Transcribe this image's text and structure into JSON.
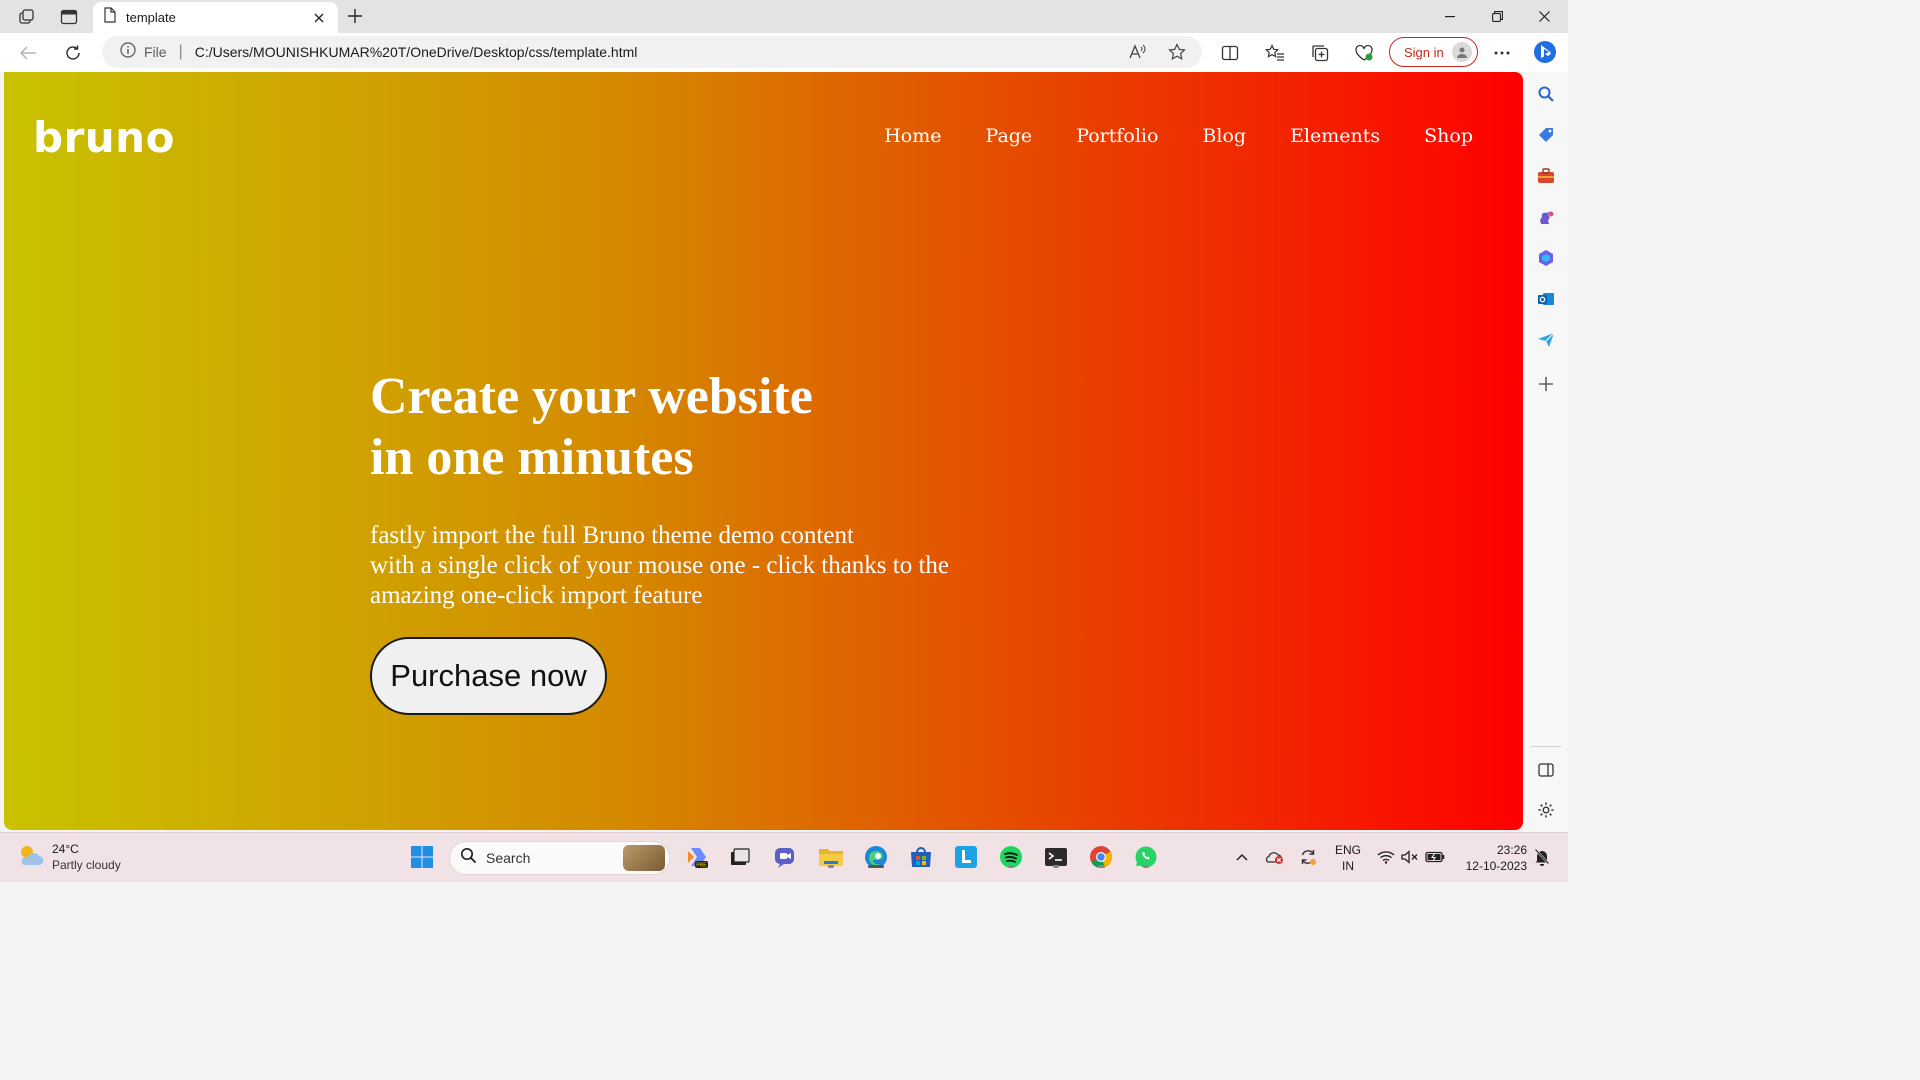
{
  "browser": {
    "tab_title": "template",
    "address": {
      "scheme_label": "File",
      "url": "C:/Users/MOUNISHKUMAR%20T/OneDrive/Desktop/css/template.html"
    },
    "signin_label": "Sign in"
  },
  "page": {
    "logo": "bruno",
    "menu": [
      "Home",
      "Page",
      "Portfolio",
      "Blog",
      "Elements",
      "Shop"
    ],
    "hero_title": [
      "Create your website",
      "in one minutes"
    ],
    "hero_desc": [
      "fastly import the full Bruno theme demo content",
      "with a single click of your mouse one - click thanks to the",
      "amazing one-click import feature"
    ],
    "cta_label": "Purchase now",
    "gradient": {
      "start": "#c9c200",
      "end": "#ff0000"
    }
  },
  "taskbar": {
    "weather": {
      "temp": "24°C",
      "condition": "Partly cloudy"
    },
    "search_placeholder": "Search",
    "lang": [
      "ENG",
      "IN"
    ],
    "clock": {
      "time": "23:26",
      "date": "12-10-2023"
    }
  },
  "colors": {
    "accent_red": "#c42b1c"
  }
}
